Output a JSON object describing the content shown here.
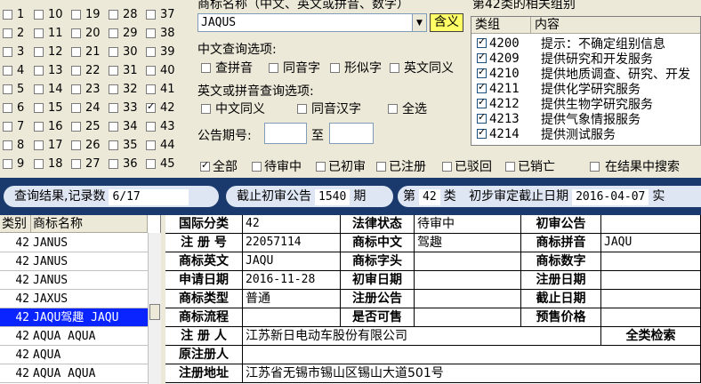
{
  "class_grid": {
    "columns": [
      [
        "1",
        "2",
        "3",
        "4",
        "5",
        "6",
        "7",
        "8",
        "9"
      ],
      [
        "10",
        "11",
        "12",
        "13",
        "14",
        "15",
        "16",
        "17",
        "18"
      ],
      [
        "19",
        "20",
        "21",
        "22",
        "23",
        "24",
        "25",
        "26",
        "27"
      ],
      [
        "28",
        "29",
        "30",
        "31",
        "32",
        "33",
        "34",
        "35",
        "36"
      ],
      [
        "37",
        "38",
        "39",
        "40",
        "41",
        "42",
        "43",
        "44",
        "45"
      ]
    ],
    "checked": [
      "42"
    ]
  },
  "search": {
    "name_label": "商标名称（中文、英文或拼音、数字）",
    "name_value": "JAQUS",
    "contains_button": "含义",
    "cn_options_label": "中文查询选项:",
    "cn_options": [
      "查拼音",
      "同音字",
      "形似字",
      "英文同义"
    ],
    "en_options_label": "英文或拼音查询选项:",
    "en_options": [
      "中文同义",
      "同音汉字",
      "全选"
    ],
    "issue_label": "公告期号:",
    "issue_to": "至"
  },
  "group_list": {
    "title": "第42类的相关组别",
    "headers": [
      "类组",
      "内容"
    ],
    "rows": [
      {
        "code": "4200",
        "text": "提示：不确定组别信息"
      },
      {
        "code": "4209",
        "text": "提供研究和开发服务"
      },
      {
        "code": "4210",
        "text": "提供地质调查、研究、开发"
      },
      {
        "code": "4211",
        "text": "提供化学研究服务"
      },
      {
        "code": "4212",
        "text": "提供生物学研究服务"
      },
      {
        "code": "4213",
        "text": "提供气象情报服务"
      },
      {
        "code": "4214",
        "text": "提供测试服务"
      }
    ]
  },
  "filters": {
    "items": [
      "全部",
      "待审中",
      "已初审",
      "已注册",
      "已驳回",
      "已销亡"
    ],
    "search_in_results": "在结果中搜索"
  },
  "bar": {
    "result_label": "查询结果,记录数",
    "result_count": "6/17",
    "cutoff_label": "截止初审公告",
    "cutoff_value": "1540",
    "cutoff_unit": "期",
    "class_prefix": "第",
    "class_value": "42",
    "class_suffix": "类",
    "date_label": "初步审定截止日期",
    "date_value": "2016-04-07",
    "trailing": "实"
  },
  "results": {
    "headers": [
      "类别",
      "商标名称"
    ],
    "rows": [
      {
        "cls": "42",
        "name": "JANUS"
      },
      {
        "cls": "42",
        "name": "JANUS"
      },
      {
        "cls": "42",
        "name": "JANUS"
      },
      {
        "cls": "42",
        "name": "JAXUS"
      },
      {
        "cls": "42",
        "name": "JAQU驾趣 JAQU"
      },
      {
        "cls": "42",
        "name": "AQUA AQUA"
      },
      {
        "cls": "42",
        "name": "AQUA"
      },
      {
        "cls": "42",
        "name": "AQUA AQUA"
      }
    ],
    "selected_index": 4
  },
  "detail": {
    "class_label": "国际分类",
    "class_value": "42",
    "legal_label": "法律状态",
    "legal_value": "待审中",
    "prelim_label": "初审公告",
    "prelim_value": "",
    "regno_label": "注 册 号",
    "regno_value": "22057114",
    "cn_label": "商标中文",
    "cn_value": "驾趣",
    "pinyin_label": "商标拼音",
    "pinyin_value": "JAQU",
    "en_label": "商标英文",
    "en_value": "JAQU",
    "head_label": "商标字头",
    "head_value": "",
    "digit_label": "商标数字",
    "digit_value": "",
    "apply_label": "申请日期",
    "apply_value": "2016-11-28",
    "prelim_date_label": "初审日期",
    "prelim_date_value": "",
    "reg_date_label": "注册日期",
    "reg_date_value": "",
    "type_label": "商标类型",
    "type_value": "普通",
    "reg_notice_label": "注册公告",
    "reg_notice_value": "",
    "end_date_label": "截止日期",
    "end_date_value": "",
    "flow_label": "商标流程",
    "flow_value": "",
    "sellable_label": "是否可售",
    "sellable_value": "",
    "presale_label": "预售价格",
    "presale_value": "",
    "registrant_label": "注 册 人",
    "registrant_value": "江苏新日电动车股份有限公司",
    "all_class_search": "全类检索",
    "orig_registrant_label": "原注册人",
    "orig_registrant_value": "",
    "address_label": "注册地址",
    "address_value": "江苏省无锡市锡山区锡山大道501号"
  }
}
